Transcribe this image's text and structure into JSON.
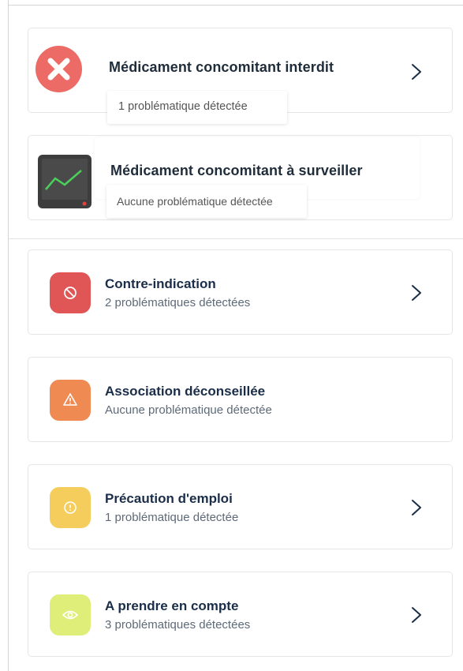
{
  "colors": {
    "title": "#1a2e4a",
    "subtitle": "#5e6a78",
    "contre": "#e05555",
    "association": "#ef8a52",
    "precaution": "#f4cd5c",
    "compte": "#dfee78",
    "red_badge": "#ec6b66"
  },
  "overlay": {
    "forbidden": {
      "title": "Médicament concomitant interdit",
      "status": "1 problématique détectée",
      "icon": "x-circle-icon"
    },
    "monitor": {
      "title": "Médicament concomitant à surveiller",
      "status": "Aucune problématique détectée",
      "icon": "monitor-chart-icon"
    }
  },
  "items": [
    {
      "title": "Contre-indication",
      "subtitle": "2 problématiques détectées",
      "icon": "ban-icon",
      "has_chevron": true
    },
    {
      "title": "Association déconseillée",
      "subtitle": "Aucune problématique détectée",
      "icon": "warning-triangle-icon",
      "has_chevron": false
    },
    {
      "title": "Précaution d'emploi",
      "subtitle": "1 problématique détectée",
      "icon": "exclamation-circle-icon",
      "has_chevron": true
    },
    {
      "title": "A prendre en compte",
      "subtitle": "3 problématiques détectées",
      "icon": "eye-icon",
      "has_chevron": true
    }
  ]
}
